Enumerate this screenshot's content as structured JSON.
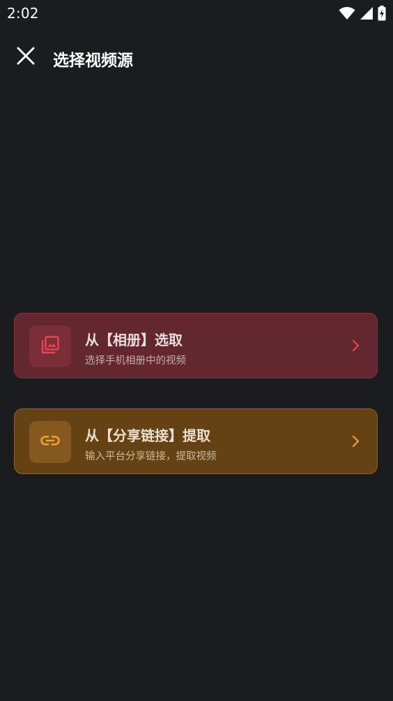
{
  "status_bar": {
    "time": "2:02"
  },
  "header": {
    "title": "选择视频源",
    "close_icon": "close-icon"
  },
  "sources": [
    {
      "title": "从【相册】选取",
      "subtitle": "选择手机相册中的视频",
      "icon": "photo-library-icon",
      "accent": "#e8454f"
    },
    {
      "title": "从【分享链接】提取",
      "subtitle": "输入平台分享链接，提取视频",
      "icon": "link-icon",
      "accent": "#f0a62e"
    }
  ],
  "colors": {
    "background": "#1b1c1f",
    "album_card": "#63272f",
    "link_card": "#654213"
  }
}
